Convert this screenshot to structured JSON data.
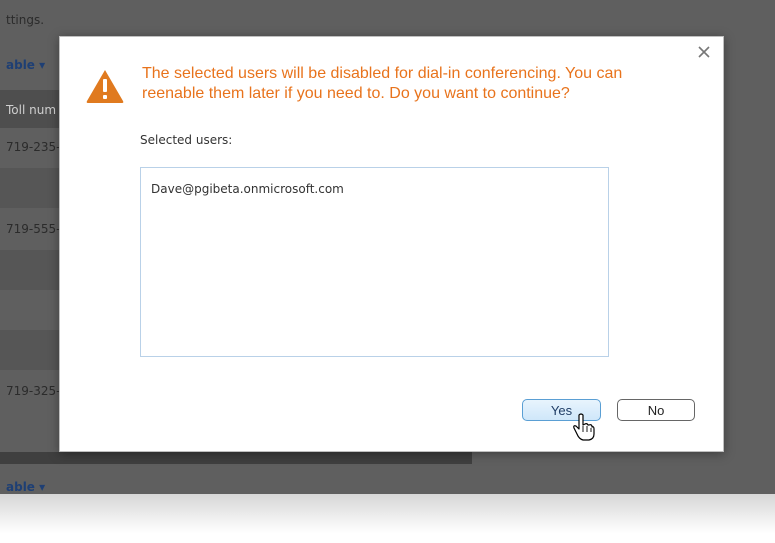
{
  "background": {
    "settings_text": "ttings.",
    "enable_link_top": "able ▾",
    "column_header": "Toll num",
    "rows": [
      "719-235-",
      "719-555-",
      "719-325-"
    ],
    "enable_link_bottom": "able ▾"
  },
  "dialog": {
    "message": "The selected users will be disabled for dial-in conferencing. You can reenable them later if you need to. Do you want to continue?",
    "selected_users_label": "Selected users:",
    "users": [
      "Dave@pgibeta.onmicrosoft.com"
    ],
    "yes_label": "Yes",
    "no_label": "No",
    "close_icon": "close-icon",
    "warning_icon": "warning-icon",
    "colors": {
      "message": "#e8731c",
      "warning": "#e07a1f"
    }
  }
}
